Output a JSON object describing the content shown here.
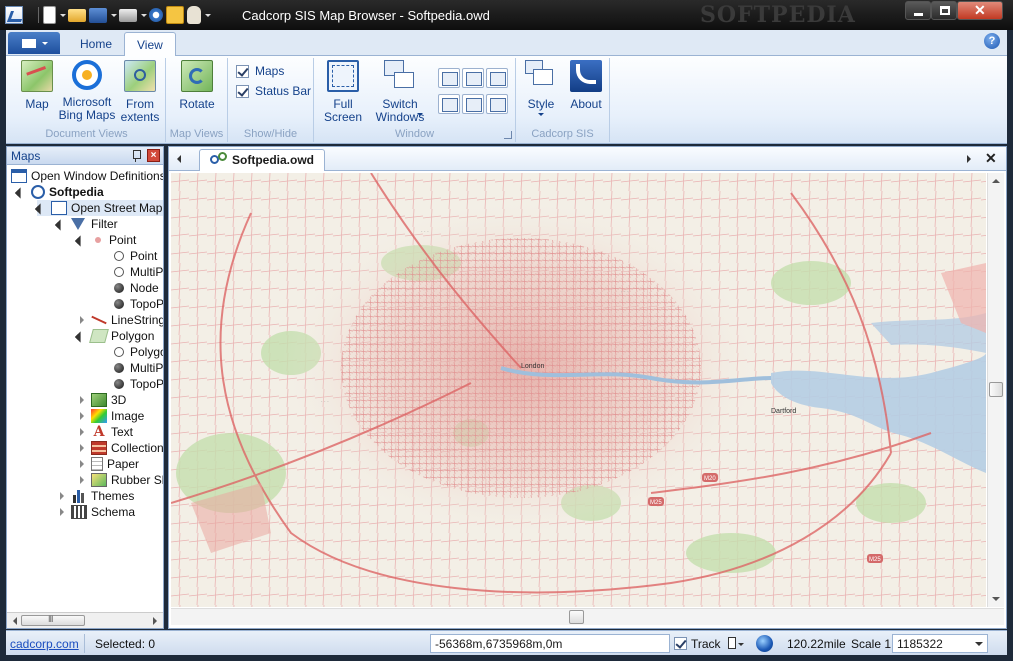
{
  "window": {
    "title": "Cadcorp SIS Map Browser - Softpedia.owd",
    "watermark": "SOFTPEDIA"
  },
  "ribbon": {
    "tabs": [
      {
        "label": "Home",
        "active": false
      },
      {
        "label": "View",
        "active": true
      }
    ],
    "groups": {
      "document_views": {
        "label": "Document Views",
        "map": "Map",
        "bing_line1": "Microsoft",
        "bing_line2": "Bing Maps",
        "extents_line1": "From",
        "extents_line2": "extents"
      },
      "map_views": {
        "label": "Map Views",
        "rotate": "Rotate"
      },
      "show_hide": {
        "label": "Show/Hide",
        "maps": "Maps",
        "status_bar": "Status Bar"
      },
      "window": {
        "label": "Window",
        "full_line1": "Full",
        "full_line2": "Screen",
        "switch_line1": "Switch",
        "switch_line2": "Windows"
      },
      "cadcorp": {
        "label": "Cadcorp SIS",
        "style": "Style",
        "about": "About"
      }
    }
  },
  "maps_panel": {
    "title": "Maps",
    "tree": [
      {
        "label": "Open Window Definitions"
      },
      {
        "label": "Softpedia"
      },
      {
        "label": "Open Street Map T"
      },
      {
        "label": "Filter"
      },
      {
        "label": "Point"
      },
      {
        "label": "Point"
      },
      {
        "label": "MultiPo"
      },
      {
        "label": "Node"
      },
      {
        "label": "TopoP"
      },
      {
        "label": "LineString"
      },
      {
        "label": "Polygon"
      },
      {
        "label": "Polygo"
      },
      {
        "label": "MultiPo"
      },
      {
        "label": "TopoP"
      },
      {
        "label": "3D"
      },
      {
        "label": "Image"
      },
      {
        "label": "Text"
      },
      {
        "label": "Collection"
      },
      {
        "label": "Paper"
      },
      {
        "label": "Rubber Sh"
      },
      {
        "label": "Themes"
      },
      {
        "label": "Schema"
      }
    ],
    "scroll_marks": "III"
  },
  "document": {
    "tab_label": "Softpedia.owd",
    "map_labels": [
      "London",
      "Dartford",
      "M25",
      "M20",
      "M25"
    ]
  },
  "statusbar": {
    "link": "cadcorp.com",
    "selected": "Selected: 0",
    "coords": "-56368m,6735968m,0m",
    "track": "Track",
    "distance": "120.22mile",
    "scale_label": "Scale 1:",
    "scale_value": "1185322"
  },
  "colors": {
    "ribbon_text": "#15428b",
    "map_bg": "#f3efe6",
    "road": "#d98a8a",
    "water": "#b5cde3",
    "green": "#b8d8a4"
  }
}
